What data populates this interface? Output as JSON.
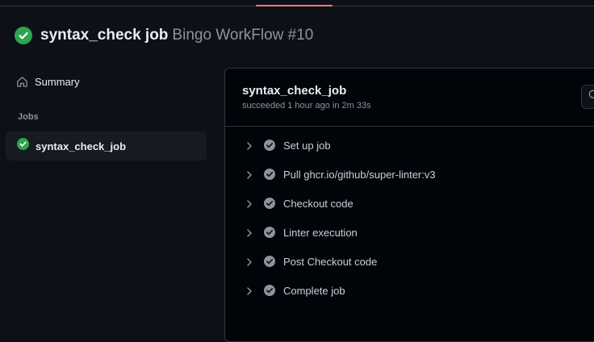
{
  "header": {
    "title": "syntax_check job",
    "subtitle": "Bingo WorkFlow #10",
    "status_color": "#2da44e"
  },
  "sidebar": {
    "summary_label": "Summary",
    "summary_icon": "home-icon",
    "jobs_heading": "Jobs",
    "jobs": [
      {
        "label": "syntax_check_job",
        "status": "success"
      }
    ]
  },
  "panel": {
    "title": "syntax_check_job",
    "meta": "succeeded 1 hour ago in 2m 33s",
    "search_icon": "search-icon",
    "steps": [
      {
        "label": "Set up job"
      },
      {
        "label": "Pull ghcr.io/github/super-linter:v3"
      },
      {
        "label": "Checkout code"
      },
      {
        "label": "Linter execution"
      },
      {
        "label": "Post Checkout code"
      },
      {
        "label": "Complete job"
      }
    ]
  },
  "colors": {
    "background": "#0d1117",
    "panel_background": "#010409",
    "border": "#30363d",
    "accent_tab": "#f78166",
    "success": "#2da44e",
    "muted_text": "#8b949e"
  }
}
